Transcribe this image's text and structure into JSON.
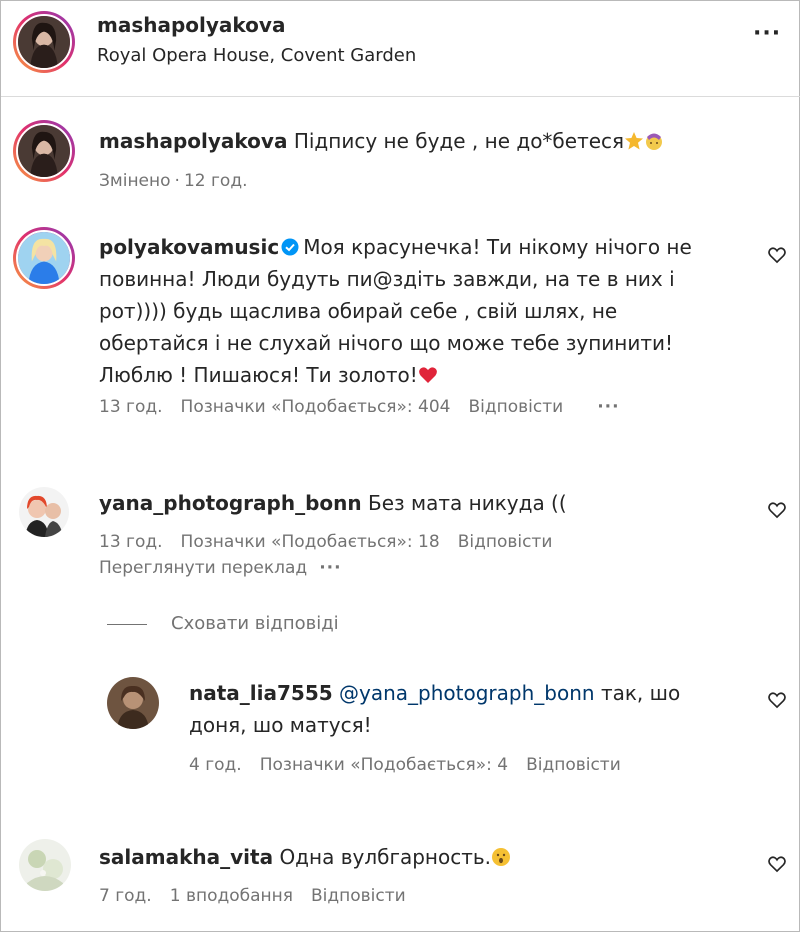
{
  "post": {
    "username": "mashapolyakova",
    "location": "Royal Opera House, Covent Garden"
  },
  "comments": [
    {
      "username": "mashapolyakova",
      "text": "Підпису не буде , не до*бетеся",
      "emoji": [
        "star-emoji",
        "facepalm-emoji"
      ],
      "meta": {
        "edited": "Змінено",
        "time": "12 год."
      }
    },
    {
      "username": "polyakovamusic",
      "verified": true,
      "lines": [
        "Моя красунечка! Ти нікому нічого не",
        "повинна! Люди будуть пи@здіть завжди, на те в них і",
        "рот)))) будь щаслива обирай себе , свій шлях, не",
        "обертайся і не слухай нічого що може тебе зупинити!",
        "Люблю ! Пишаюся! Ти золото!"
      ],
      "emoji": [
        "heart-emoji"
      ],
      "meta": {
        "time": "13 год.",
        "likes": "Позначки «Подобається»: 404",
        "reply": "Відповісти"
      }
    },
    {
      "username": "yana_photograph_bonn",
      "text": "Без мата никуда ((",
      "meta": {
        "time": "13 год.",
        "likes": "Позначки «Подобається»: 18",
        "reply": "Відповісти",
        "translate": "Переглянути переклад"
      }
    },
    {
      "username": "nata_lia7555",
      "mention": "@yana_photograph_bonn",
      "text_line1": "так, шо",
      "text_line2": "доня, шо матуся!",
      "meta": {
        "time": "4 год.",
        "likes": "Позначки «Подобається»: 4",
        "reply": "Відповісти"
      }
    },
    {
      "username": "salamakha_vita",
      "text": "Одна вулбгарность.",
      "emoji": [
        "surprised-emoji"
      ],
      "meta": {
        "time": "7 год.",
        "likes": "1 вподобання",
        "reply": "Відповісти"
      }
    }
  ],
  "hide_replies": "Сховати відповіді",
  "colors": {
    "text": "#262626",
    "secondary": "#737373",
    "mention": "#00376b",
    "verified": "#0095f6"
  }
}
